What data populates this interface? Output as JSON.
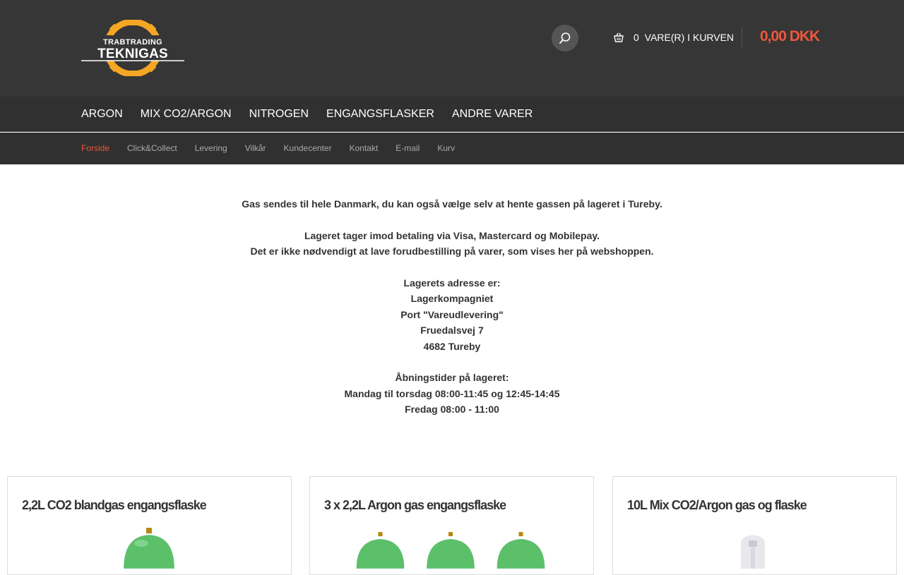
{
  "header": {
    "logo": {
      "top_text": "TRABTRADING",
      "main_text": "TEKNIGAS"
    },
    "search": {
      "icon": "search-icon"
    },
    "cart": {
      "icon": "basket-icon",
      "count": "0",
      "label": "VARE(R) I KURVEN",
      "total": "0,00 DKK"
    }
  },
  "main_nav": {
    "items": [
      "ARGON",
      "MIX CO2/ARGON",
      "NITROGEN",
      "ENGANGSFLASKER",
      "ANDRE VARER"
    ]
  },
  "sub_nav": {
    "items": [
      "Forside",
      "Click&Collect",
      "Levering",
      "Vilkår",
      "Kundecenter",
      "Kontakt",
      "E-mail",
      "Kurv"
    ],
    "active": "Forside"
  },
  "intro": {
    "lines": [
      "Gas sendes til hele Danmark, du kan også vælge selv at hente gassen på lageret i Tureby.",
      "",
      "Lageret tager imod betaling via Visa, Mastercard og Mobilepay.",
      "Det er ikke nødvendigt at lave forudbestilling på varer, som vises her på webshoppen.",
      "",
      "Lagerets adresse er:",
      "Lagerkompagniet",
      "Port \"Vareudlevering\"",
      "Fruedalsvej 7",
      "4682 Tureby",
      "",
      "Åbningstider på lageret:",
      "Mandag til torsdag 08:00-11:45 og 12:45-14:45",
      "Fredag 08:00 - 11:00"
    ]
  },
  "products": [
    {
      "title": "2,2L CO2 blandgas engangsflaske"
    },
    {
      "title": "3 x 2,2L Argon gas engangsflaske"
    },
    {
      "title": "10L Mix CO2/Argon gas og flaske"
    }
  ],
  "colors": {
    "accent": "#f0563c",
    "header_bg": "#363636",
    "nav_bg": "#303030",
    "logo_orange": "#f5a623",
    "cylinder_green": "#5cc06a"
  }
}
